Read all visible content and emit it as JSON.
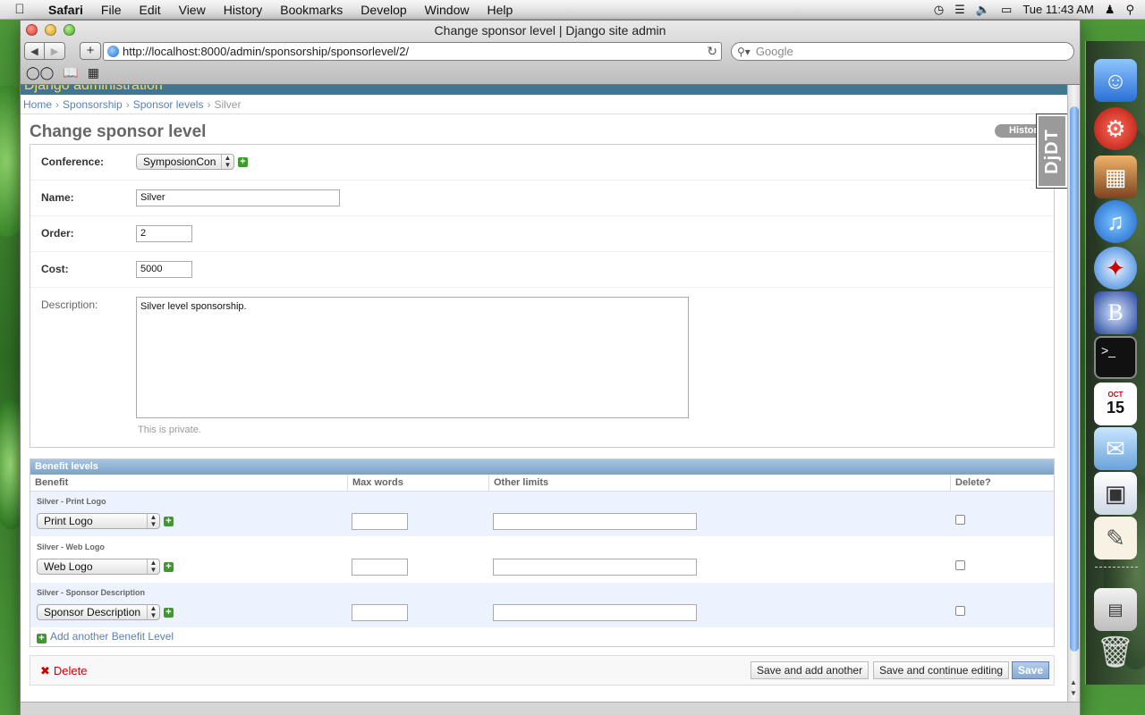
{
  "menubar": {
    "app": "Safari",
    "items": [
      "File",
      "Edit",
      "View",
      "History",
      "Bookmarks",
      "Develop",
      "Window",
      "Help"
    ],
    "clock": "Tue 11:43 AM"
  },
  "browser": {
    "window_title": "Change sponsor level | Django site admin",
    "url": "http://localhost:8000/admin/sponsorship/sponsorlevel/2/",
    "search_placeholder": "Google"
  },
  "admin": {
    "brand": "Django administration",
    "breadcrumbs": [
      "Home",
      "Sponsorship",
      "Sponsor levels",
      "Silver"
    ],
    "page_title": "Change sponsor level",
    "history_button": "History",
    "ddt_label": "DjDT",
    "form": {
      "conference_label": "Conference:",
      "conference_value": "SymposionCon",
      "name_label": "Name:",
      "name_value": "Silver",
      "order_label": "Order:",
      "order_value": "2",
      "cost_label": "Cost:",
      "cost_value": "5000",
      "description_label": "Description:",
      "description_value": "Silver level sponsorship.",
      "description_help": "This is private."
    },
    "inline": {
      "title": "Benefit levels",
      "columns": [
        "Benefit",
        "Max words",
        "Other limits",
        "Delete?"
      ],
      "rows": [
        {
          "label": "Silver - Print Logo",
          "benefit": "Print Logo",
          "max_words": "",
          "other_limits": ""
        },
        {
          "label": "Silver - Web Logo",
          "benefit": "Web Logo",
          "max_words": "",
          "other_limits": ""
        },
        {
          "label": "Silver - Sponsor Description",
          "benefit": "Sponsor Description",
          "max_words": "",
          "other_limits": ""
        }
      ],
      "add_another": "Add another Benefit Level"
    },
    "submit": {
      "delete": "Delete",
      "save_add": "Save and add another",
      "save_continue": "Save and continue editing",
      "save": "Save"
    }
  },
  "dock": {
    "calendar_month": "OCT",
    "calendar_day": "15",
    "icons": [
      "finder-icon",
      "flash-icon",
      "iphoto-icon",
      "itunes-icon",
      "safari-icon",
      "bbedit-icon",
      "terminal-icon",
      "ical-icon",
      "mail-icon",
      "preview-icon",
      "textedit-icon",
      "documents-stack-icon",
      "trash-icon"
    ]
  },
  "colors": {
    "django_header": "#417690",
    "link": "#5b80b2",
    "delete": "#cc0000",
    "inline_head": "#7ca0c7"
  }
}
